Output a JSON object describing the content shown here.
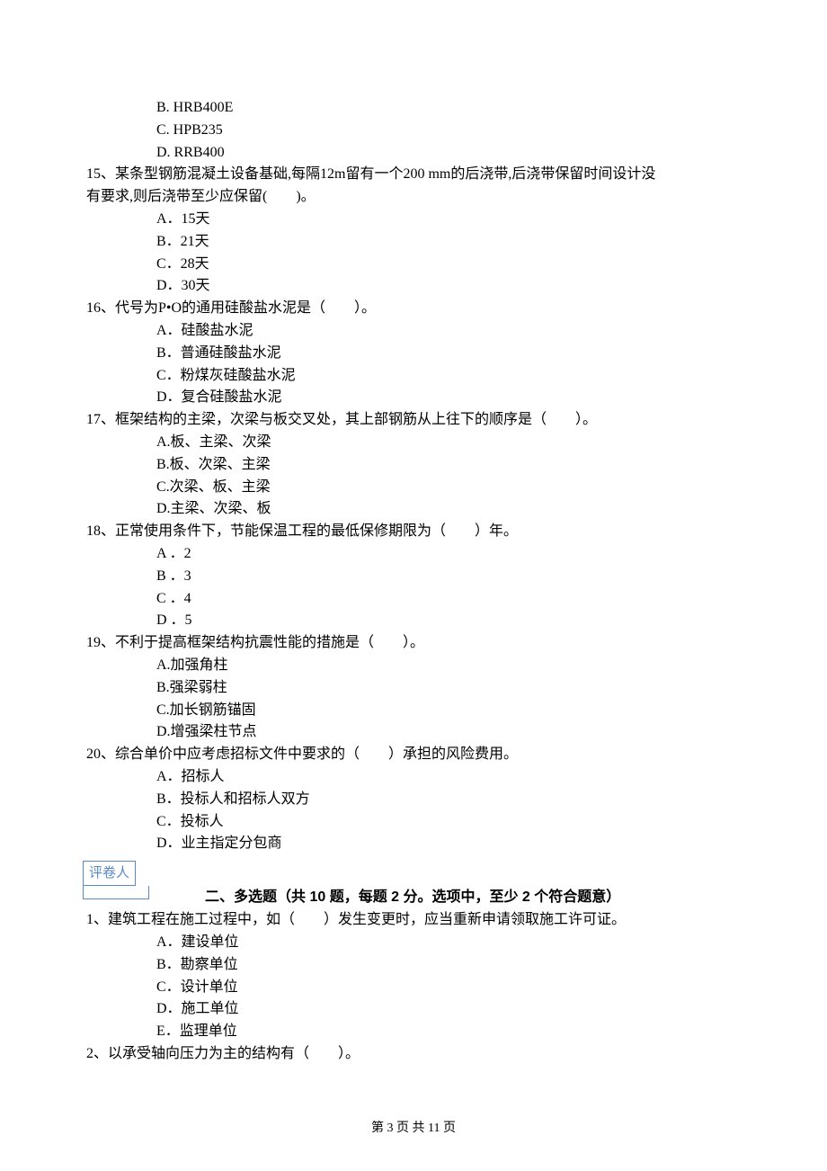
{
  "frag14": {
    "B": "B. HRB400E",
    "C": "C. HPB235",
    "D": "D. RRB400"
  },
  "q15": {
    "stem1": "15、某条型钢筋混凝土设备基础,每隔12m留有一个200 mm的后浇带,后浇带保留时间设计没",
    "stem2": "有要求,则后浇带至少应保留(　　)。",
    "A": "A．15天",
    "B": "B．21天",
    "C": "C．28天",
    "D": "D．30天"
  },
  "q16": {
    "stem": "16、代号为P•O的通用硅酸盐水泥是（　　）。",
    "A": "A．硅酸盐水泥",
    "B": "B．普通硅酸盐水泥",
    "C": "C．粉煤灰硅酸盐水泥",
    "D": "D．复合硅酸盐水泥"
  },
  "q17": {
    "stem": "17、框架结构的主梁，次梁与板交叉处，其上部钢筋从上往下的顺序是（　　）。",
    "A": "A.板、主梁、次梁",
    "B": "B.板、次梁、主梁",
    "C": "C.次梁、板、主梁",
    "D": "D.主梁、次梁、板"
  },
  "q18": {
    "stem": "18、正常使用条件下，节能保温工程的最低保修期限为（　　）年。",
    "A": "A ．2",
    "B": "B ．3",
    "C": "C ．4",
    "D": "D ．5"
  },
  "q19": {
    "stem": "19、不利于提高框架结构抗震性能的措施是（　　）。",
    "A": "A.加强角柱",
    "B": "B.强梁弱柱",
    "C": "C.加长钢筋锚固",
    "D": "D.增强梁柱节点"
  },
  "q20": {
    "stem": "20、综合单价中应考虑招标文件中要求的（　　）承担的风险费用。",
    "A": "A．招标人",
    "B": "B．投标人和招标人双方",
    "C": "C．投标人",
    "D": "D．业主指定分包商"
  },
  "grader_label": "评卷人",
  "section2_title": "二、多选题（共 10 题，每题 2 分。选项中，至少 2 个符合题意）",
  "mq1": {
    "stem": "1、建筑工程在施工过程中，如（　　）发生变更时，应当重新申请领取施工许可证。",
    "A": "A．建设单位",
    "B": "B．勘察单位",
    "C": "C．设计单位",
    "D": "D．施工单位",
    "E": "E．监理单位"
  },
  "mq2": {
    "stem": "2、以承受轴向压力为主的结构有（　　）。"
  },
  "footer": "第 3 页 共 11 页"
}
